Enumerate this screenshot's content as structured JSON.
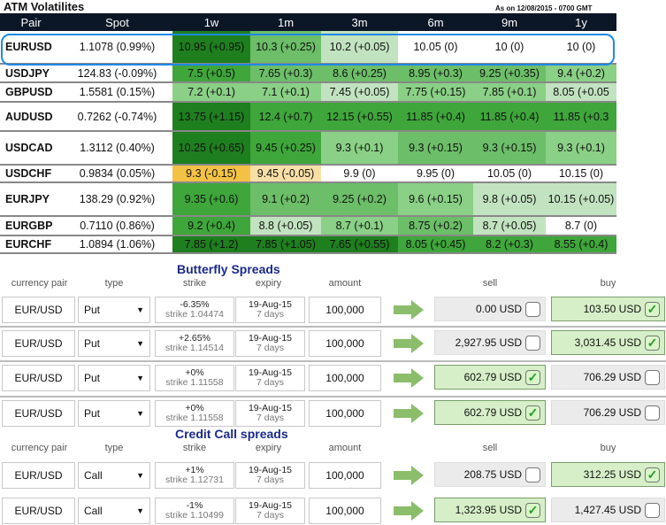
{
  "atm": {
    "title": "ATM Volatilites",
    "as_of": "As on 12/08/2015 - 0700 GMT",
    "columns": [
      "Pair",
      "Spot",
      "1w",
      "1m",
      "3m",
      "6m",
      "9m",
      "1y"
    ],
    "rows": [
      {
        "pair": "EURUSD",
        "spot": "1.1078 (0.99%)",
        "cells": [
          "10.95 (+0.95)",
          "10.3 (+0.25)",
          "10.2 (+0.05)",
          "10.05 (0)",
          "10 (0)",
          "10 (0)"
        ],
        "levels": [
          "l5",
          "l3",
          "l1",
          "l0",
          "l0",
          "l0"
        ]
      },
      {
        "pair": "USDJPY",
        "spot": "124.83 (-0.09%)",
        "cells": [
          "7.5 (+0.5)",
          "7.65 (+0.3)",
          "8.6 (+0.25)",
          "8.95 (+0.3)",
          "9.25 (+0.35)",
          "9.4 (+0.2)"
        ],
        "levels": [
          "l4",
          "l3",
          "l3",
          "l3",
          "l3",
          "l2"
        ]
      },
      {
        "pair": "GBPUSD",
        "spot": "1.5581 (0.15%)",
        "cells": [
          "7.2 (+0.1)",
          "7.1 (+0.1)",
          "7.45 (+0.05)",
          "7.75 (+0.15)",
          "7.85 (+0.1)",
          "8.05 (+0.05"
        ],
        "levels": [
          "l2",
          "l2",
          "l1",
          "l2",
          "l2",
          "l1"
        ]
      },
      {
        "pair": "AUDUSD",
        "spot": "0.7262 (-0.74%)",
        "cells": [
          "13.75 (+1.15)",
          "12.4 (+0.7)",
          "12.15 (+0.55)",
          "11.85 (+0.4)",
          "11.85 (+0.4)",
          "11.85 (+0.3"
        ],
        "levels": [
          "l5",
          "l4",
          "l4",
          "l4",
          "l4",
          "l4"
        ]
      },
      {
        "pair": "USDCAD",
        "spot": "1.3112 (0.40%)",
        "cells": [
          "10.25 (+0.65)",
          "9.45 (+0.25)",
          "9.3 (+0.1)",
          "9.3 (+0.15)",
          "9.3 (+0.15)",
          "9.3 (+0.1)"
        ],
        "levels": [
          "l5",
          "l4",
          "l2",
          "l3",
          "l3",
          "l2"
        ]
      },
      {
        "pair": "USDCHF",
        "spot": "0.9834 (0.05%)",
        "cells": [
          "9.3 (-0.15)",
          "9.45 (-0.05)",
          "9.9 (0)",
          "9.95 (0)",
          "10.05 (0)",
          "10.15 (0)"
        ],
        "levels": [
          "o1",
          "o2",
          "l0",
          "l0",
          "l0",
          "l0"
        ]
      },
      {
        "pair": "EURJPY",
        "spot": "138.29 (0.92%)",
        "cells": [
          "9.35 (+0.6)",
          "9.1 (+0.2)",
          "9.25 (+0.2)",
          "9.6 (+0.15)",
          "9.8 (+0.05)",
          "10.15 (+0.05)"
        ],
        "levels": [
          "l4",
          "l3",
          "l3",
          "l2",
          "l1",
          "l1"
        ]
      },
      {
        "pair": "EURGBP",
        "spot": "0.7110 (0.86%)",
        "cells": [
          "9.2 (+0.4)",
          "8.8 (+0.05)",
          "8.7 (+0.1)",
          "8.75 (+0.2)",
          "8.7 (+0.05)",
          "8.7 (0)"
        ],
        "levels": [
          "l4",
          "l1",
          "l2",
          "l3",
          "l1",
          "l0"
        ]
      },
      {
        "pair": "EURCHF",
        "spot": "1.0894 (1.06%)",
        "cells": [
          "7.85 (+1.2)",
          "7.85 (+1.05)",
          "7.65 (+0.55)",
          "8.05 (+0.45)",
          "8.2 (+0.3)",
          "8.55 (+0.4)"
        ],
        "levels": [
          "l5",
          "l5",
          "l5",
          "l4",
          "l4",
          "l4"
        ]
      }
    ]
  },
  "headers": {
    "pair": "currency pair",
    "type": "type",
    "strike": "strike",
    "expiry": "expiry",
    "amount": "amount",
    "sell": "sell",
    "buy": "buy"
  },
  "sections": [
    {
      "title": "Butterfly Spreads",
      "rows": [
        {
          "pair": "EUR/USD",
          "type": "Put",
          "strike_pct": "-6.35%",
          "strike": "strike 1.04474",
          "expiry": "19-Aug-15",
          "days": "7 days",
          "amount": "100,000",
          "sell": "0.00 USD",
          "buy": "103.50 USD",
          "selected": "buy"
        },
        {
          "pair": "EUR/USD",
          "type": "Put",
          "strike_pct": "+2.65%",
          "strike": "strike 1.14514",
          "expiry": "19-Aug-15",
          "days": "7 days",
          "amount": "100,000",
          "sell": "2,927.95 USD",
          "buy": "3,031.45 USD",
          "selected": "buy"
        },
        {
          "pair": "EUR/USD",
          "type": "Put",
          "strike_pct": "+0%",
          "strike": "strike 1.11558",
          "expiry": "19-Aug-15",
          "days": "7 days",
          "amount": "100,000",
          "sell": "602.79 USD",
          "buy": "706.29 USD",
          "selected": "sell"
        },
        {
          "pair": "EUR/USD",
          "type": "Put",
          "strike_pct": "+0%",
          "strike": "strike 1.11558",
          "expiry": "19-Aug-15",
          "days": "7 days",
          "amount": "100,000",
          "sell": "602.79 USD",
          "buy": "706.29 USD",
          "selected": "sell"
        }
      ]
    },
    {
      "title": "Credit Call spreads",
      "rows": [
        {
          "pair": "EUR/USD",
          "type": "Call",
          "strike_pct": "+1%",
          "strike": "strike 1.12731",
          "expiry": "19-Aug-15",
          "days": "7 days",
          "amount": "100,000",
          "sell": "208.75 USD",
          "buy": "312.25 USD",
          "selected": "buy"
        },
        {
          "pair": "EUR/USD",
          "type": "Call",
          "strike_pct": "-1%",
          "strike": "strike 1.10499",
          "expiry": "19-Aug-15",
          "days": "7 days",
          "amount": "100,000",
          "sell": "1,323.95 USD",
          "buy": "1,427.45 USD",
          "selected": "sell"
        }
      ]
    }
  ]
}
